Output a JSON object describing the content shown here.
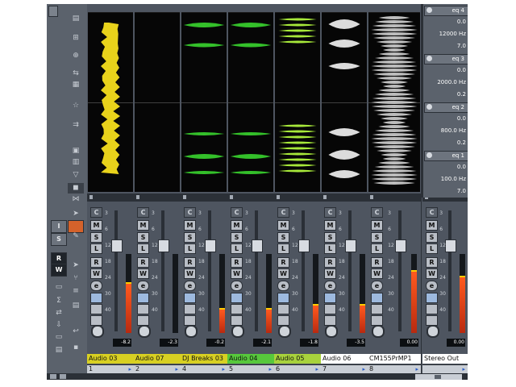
{
  "channels": [
    {
      "name": "Audio 03",
      "number": "1",
      "volume": "-8.2",
      "color": "#d8d022",
      "wave": "yellow",
      "meter": 0.62
    },
    {
      "name": "Audio 07",
      "number": "2",
      "volume": "-2.3",
      "color": "#d8d022",
      "wave": "none",
      "meter": 0.0
    },
    {
      "name": "DJ Breaks 03",
      "number": "4",
      "volume": "-0.2",
      "color": "#d8d022",
      "wave": "green",
      "meter": 0.3
    },
    {
      "name": "Audio 04",
      "number": "5",
      "volume": "-2.1",
      "color": "#57c83c",
      "wave": "green",
      "meter": 0.3
    },
    {
      "name": "Audio 05",
      "number": "6",
      "volume": "-1.8",
      "color": "#a8d23c",
      "wave": "greenyellow",
      "meter": 0.35
    },
    {
      "name": "Audio 06",
      "number": "7",
      "volume": "-3.5",
      "color": "#ffffff",
      "wave": "white",
      "meter": 0.35
    },
    {
      "name": "CM155PrMP1",
      "number": "8",
      "volume": "0.00",
      "color": "#ffffff",
      "wave": "grey",
      "meter": 0.78
    },
    {
      "name": "Stereo Out",
      "number": "",
      "volume": "0.00",
      "color": "#ffffff",
      "wave": "none",
      "meter": 0.7
    }
  ],
  "eq": [
    {
      "label": "eq 4",
      "gain": "0.0",
      "freq": "12000 Hz",
      "q": "7.0"
    },
    {
      "label": "eq 3",
      "gain": "0.0",
      "freq": "2000.0 Hz",
      "q": "0.2"
    },
    {
      "label": "eq 2",
      "gain": "0.0",
      "freq": "800.0 Hz",
      "q": "0.2"
    },
    {
      "label": "eq 1",
      "gain": "0.0",
      "freq": "100.0 Hz",
      "q": "7.0"
    }
  ],
  "strip_buttons": {
    "c": "C",
    "m": "M",
    "s": "S",
    "l": "L",
    "r": "R",
    "w": "W",
    "e": "e"
  },
  "left_tools": {
    "i": "I",
    "s": "S",
    "r": "R",
    "w": "W"
  },
  "scale_ticks": [
    "3",
    "6",
    "12",
    "18",
    "24",
    "30",
    "40"
  ]
}
